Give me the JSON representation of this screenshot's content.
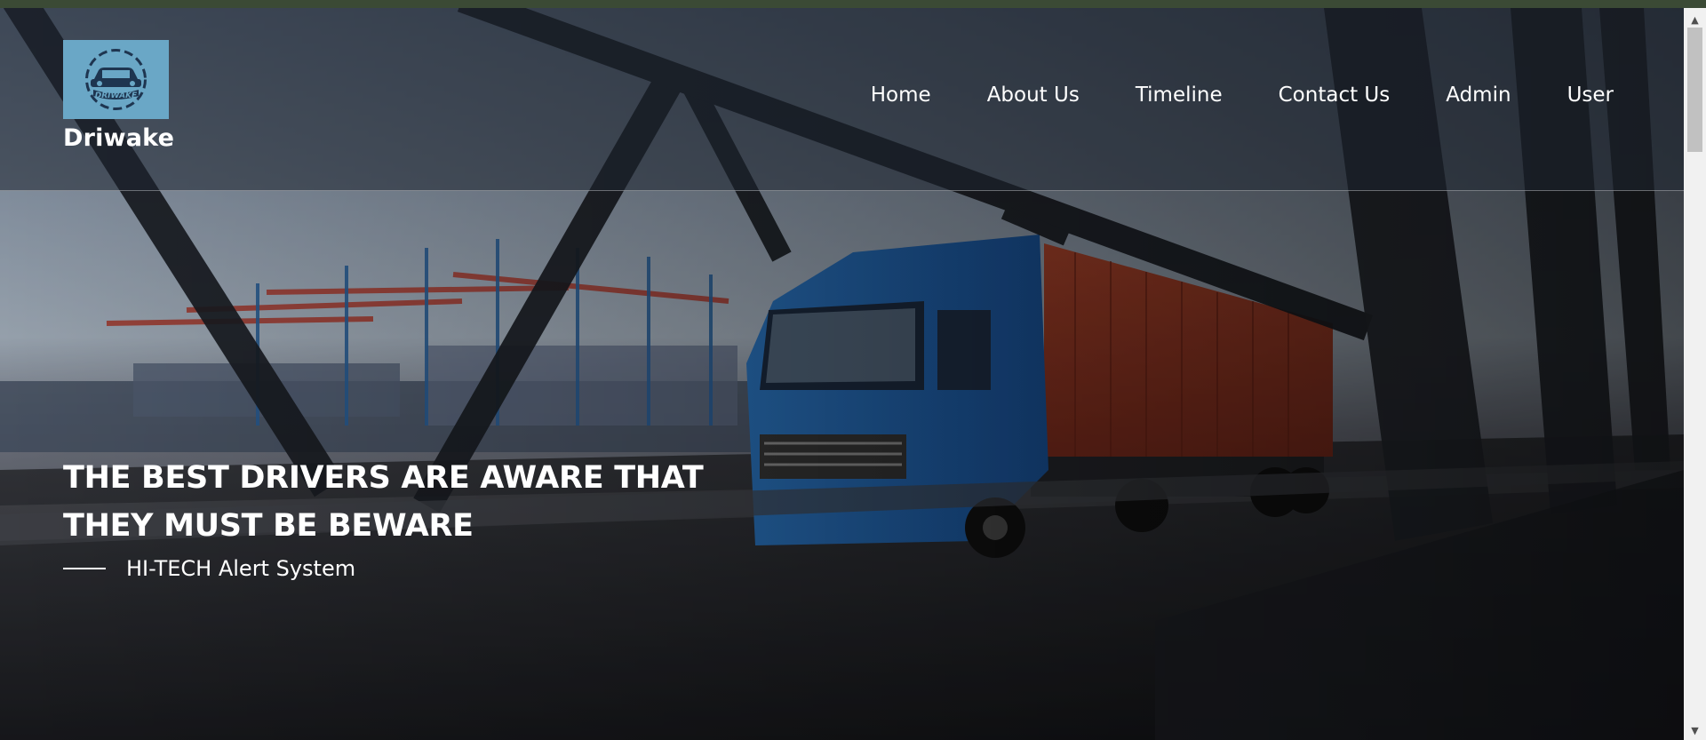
{
  "brand": {
    "logo_text": "DRIWAKE",
    "name": "Driwake",
    "logo_bg": "#6aa7c6"
  },
  "nav": {
    "items": [
      {
        "label": "Home"
      },
      {
        "label": "About Us"
      },
      {
        "label": "Timeline"
      },
      {
        "label": "Contact Us"
      },
      {
        "label": "Admin"
      },
      {
        "label": "User"
      }
    ]
  },
  "hero": {
    "headline_line1": "THE BEST DRIVERS ARE AWARE THAT",
    "headline_line2": "THEY MUST BE BEWARE",
    "tagline": "HI-TECH Alert System",
    "image_description_icon": "truck-on-bridge-photo"
  },
  "scrollbar": {
    "up_icon": "scroll-up-arrow-icon",
    "down_icon": "scroll-down-arrow-icon"
  },
  "colors": {
    "top_strip": "#3b4a35",
    "truck_cab": "#2f7fd0",
    "container": "#b9442b"
  }
}
